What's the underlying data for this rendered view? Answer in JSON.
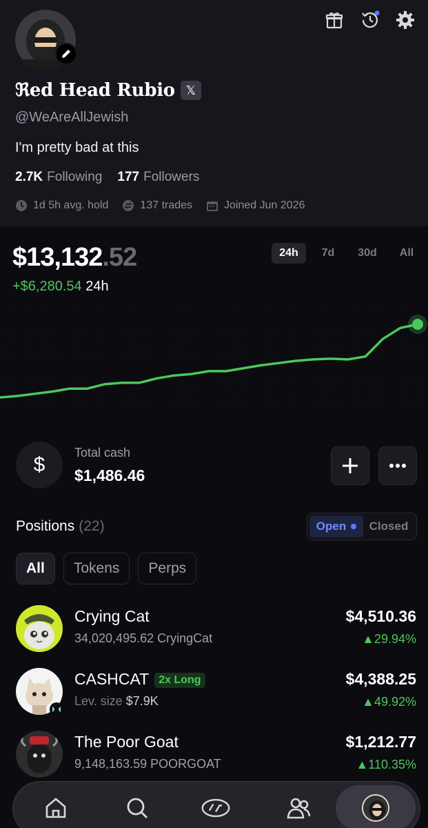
{
  "profile": {
    "name": "ℜed Head Rubio",
    "x_badge": "𝕏",
    "handle": "@WeAreAllJewish",
    "bio": "I'm pretty bad at this",
    "following_count": "2.7K",
    "following_label": "Following",
    "followers_count": "177",
    "followers_label": "Followers",
    "avg_hold": "1d 5h avg. hold",
    "trades": "137 trades",
    "joined": "Joined Jun 2026"
  },
  "portfolio": {
    "balance_main": "$13,132",
    "balance_cents": ".52",
    "pnl_value": "+$6,280.54",
    "pnl_period": "24h",
    "ranges": [
      "24h",
      "7d",
      "30d",
      "All"
    ],
    "active_range": "24h"
  },
  "chart_data": {
    "type": "line",
    "description_series": "portfolio value 24h",
    "values": [
      0.0,
      0.02,
      0.05,
      0.08,
      0.12,
      0.12,
      0.18,
      0.2,
      0.2,
      0.26,
      0.3,
      0.32,
      0.36,
      0.36,
      0.4,
      0.44,
      0.47,
      0.5,
      0.52,
      0.53,
      0.52,
      0.56,
      0.8,
      0.95,
      1.0
    ],
    "color": "#4cc85a"
  },
  "cash": {
    "icon": "$",
    "label": "Total cash",
    "value": "$1,486.46"
  },
  "positions": {
    "title": "Positions",
    "count": "(22)",
    "toggle_open": "Open",
    "toggle_closed": "Closed",
    "filters": [
      "All",
      "Tokens",
      "Perps"
    ],
    "items": [
      {
        "name": "Crying Cat",
        "sub": "34,020,495.62 CryingCat",
        "value": "$4,510.36",
        "change": "▲29.94%"
      },
      {
        "name": "CASHCAT",
        "badge": "2x Long",
        "sub_label": "Lev. size",
        "sub_value": "$7.9K",
        "value": "$4,388.25",
        "change": "▲49.92%"
      },
      {
        "name": "The Poor Goat",
        "sub": "9,148,163.59 POORGOAT",
        "value": "$1,212.77",
        "change": "▲110.35%"
      }
    ]
  },
  "colors": {
    "accent_green": "#4cc85a",
    "accent_blue": "#5b7cff",
    "background": "#0b0b10"
  }
}
